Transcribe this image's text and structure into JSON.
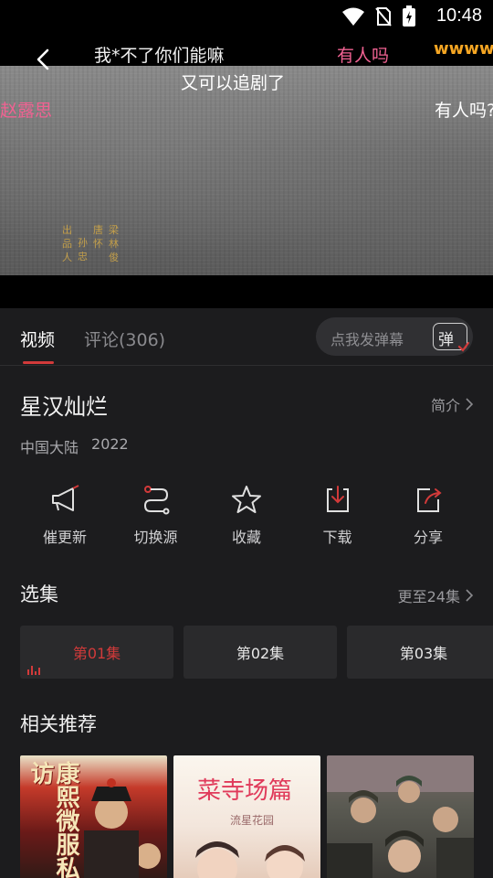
{
  "status_bar": {
    "time": "10:48"
  },
  "video": {
    "danmaku": [
      {
        "text": "我*不了你们能嘛",
        "color": "#f0f0f0"
      },
      {
        "text": "有人吗",
        "color": "#f06292"
      },
      {
        "text": "wwwwa",
        "color": "#f5a623"
      },
      {
        "text": "又可以追剧了",
        "color": "#ffffff"
      },
      {
        "text": "赵露思",
        "color": "#f06292"
      },
      {
        "text": "有人吗?",
        "color": "#ffffff"
      }
    ],
    "credits": [
      [
        "出",
        "品",
        "人"
      ],
      [
        "孙",
        "忠"
      ],
      [
        "唐",
        "怀"
      ],
      [
        "梁",
        "林",
        "俊"
      ]
    ]
  },
  "tabs": {
    "video_label": "视频",
    "comments_label": "评论(306)",
    "danmaku_placeholder": "点我发弹幕",
    "danmaku_toggle_label": "弹"
  },
  "show": {
    "title": "星汉灿烂",
    "intro_label": "简介",
    "region": "中国大陆",
    "year": "2022"
  },
  "actions": [
    {
      "label": "催更新",
      "icon": "megaphone-icon"
    },
    {
      "label": "切换源",
      "icon": "switch-source-icon"
    },
    {
      "label": "收藏",
      "icon": "star-icon"
    },
    {
      "label": "下载",
      "icon": "download-icon"
    },
    {
      "label": "分享",
      "icon": "share-icon"
    }
  ],
  "episodes_section": {
    "title": "选集",
    "more_label": "更至24集",
    "episodes": [
      "第01集",
      "第02集",
      "第03集"
    ],
    "active_index": 0
  },
  "recommend_section": {
    "title": "相关推荐",
    "posters": [
      {
        "text": "康熙微服私访"
      },
      {
        "text": "菜寺场篇",
        "subtitle": "流星花园"
      },
      {
        "text": ""
      }
    ]
  },
  "colors": {
    "accent": "#d23a3a",
    "background": "#1c1c1e"
  }
}
